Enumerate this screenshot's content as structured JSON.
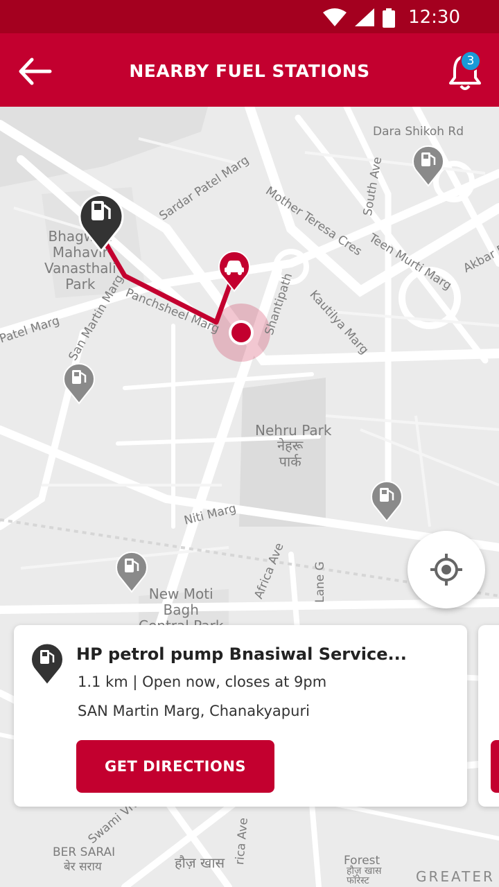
{
  "status_bar": {
    "time": "12:30"
  },
  "header": {
    "title": "NEARBY FUEL STATIONS",
    "notification_count": "3"
  },
  "map": {
    "labels": {
      "dara_shikoh": "Dara Shikoh Rd",
      "mother_teresa": "Mother Teresa Cres",
      "south_ave": "South Ave",
      "sardar_patel": "Sardar Patel Marg",
      "teen_murti": "Teen Murti Marg",
      "akbar": "Akbar R",
      "kautilya": "Kautilya Marg",
      "shantipath": "Shantipath",
      "panchsheel": "Panchsheel Marg",
      "san_martin": "San Martin Marg",
      "patel_marg": "Patel Marg",
      "bhagwan": "Bhagwan\nMahavir\nVanasthali\nPark",
      "nehru_park": "Nehru Park",
      "nehru_park_hi": "नेहरू\nपार्क",
      "niti_marg": "Niti Marg",
      "africa_ave": "Africa Ave",
      "lane_g": "Lane G",
      "new_moti": "New Moti\nBagh\nCentral Park",
      "vivekanand": "Swami Vivekanand Marg",
      "rica_ave": "rica Ave",
      "ber_sarai": "BER SARAI",
      "ber_sarai_hi": "बेर सराय",
      "hauz_khas_hi": "हौज़ खास",
      "forest": "Forest",
      "forest_hi": "हौज़ खास\nफॉरेस्ट",
      "greater": "GREATER"
    }
  },
  "station_card": {
    "name": "HP petrol pump Bnasiwal Service...",
    "distance": "1.1 km",
    "status": "Open now, closes at 9pm",
    "meta": "1.1 km | Open now, closes at 9pm",
    "address": "SAN Martin Marg, Chanakyapuri",
    "cta": "GET DIRECTIONS"
  },
  "colors": {
    "primary": "#c3002f",
    "status_bar": "#a4001f",
    "badge": "#1a9ad6",
    "pin_gray": "#8a8a8a",
    "pin_dark": "#333333"
  },
  "icons": [
    "back-arrow-icon",
    "bell-icon",
    "fuel-pump-icon",
    "car-icon",
    "crosshair-icon",
    "wifi-icon",
    "signal-icon",
    "battery-icon"
  ]
}
